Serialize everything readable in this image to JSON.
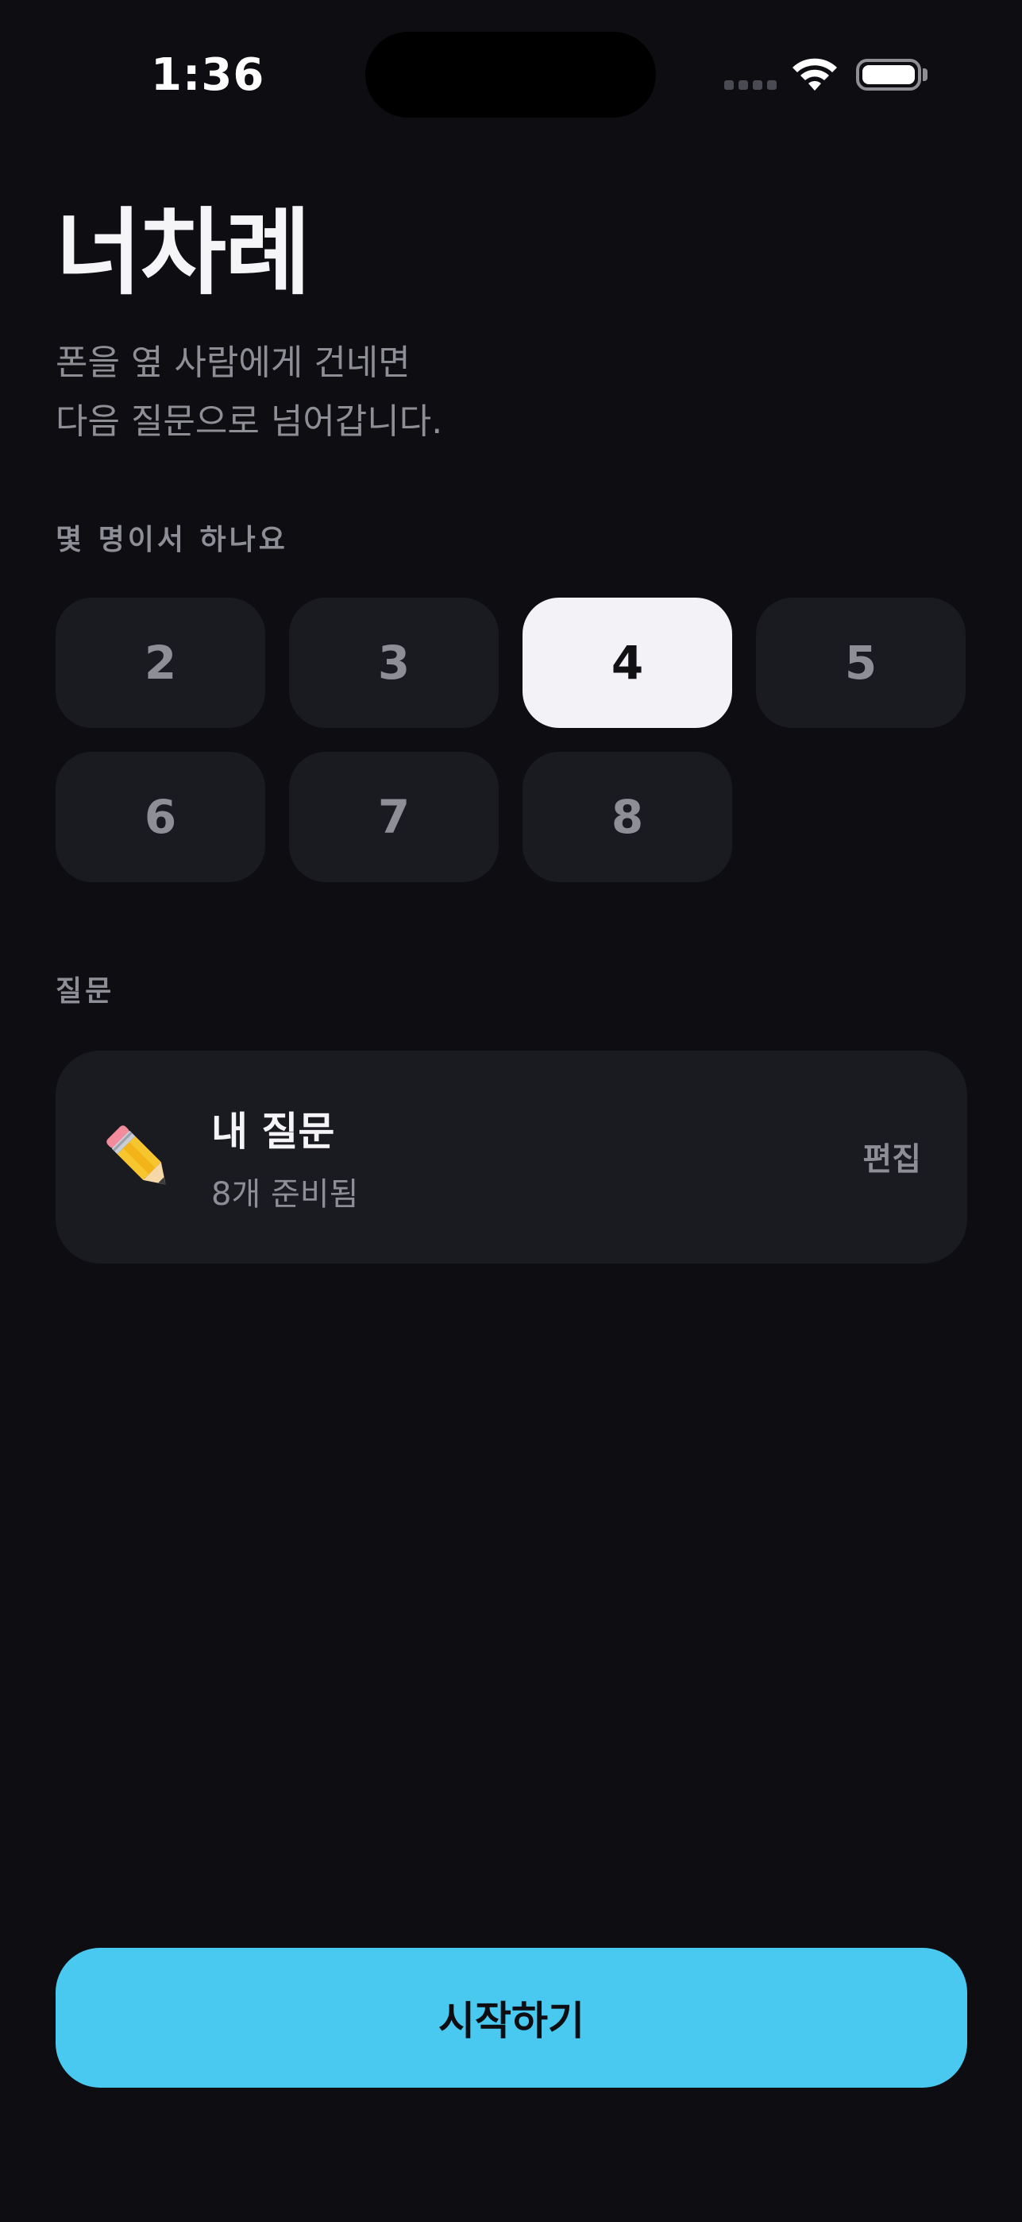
{
  "status_bar": {
    "time": "1:36"
  },
  "header": {
    "title": "너차례",
    "subtitle_line1": "폰을 옆 사람에게 건네면",
    "subtitle_line2": "다음 질문으로 넘어갑니다."
  },
  "players": {
    "label": "몇 명이서 하나요",
    "options": [
      "2",
      "3",
      "4",
      "5",
      "6",
      "7",
      "8"
    ],
    "selected": "4"
  },
  "questions": {
    "label": "질문",
    "card": {
      "icon": "pencil-icon",
      "title": "내 질문",
      "subtitle": "8개 준비됨",
      "edit_label": "편집"
    }
  },
  "footer": {
    "start_label": "시작하기"
  },
  "colors": {
    "background": "#0d0d12",
    "card": "#1a1a21",
    "accent": "#4ac9f0",
    "selected": "#f2f2f7",
    "muted_text": "#8e8e96"
  }
}
